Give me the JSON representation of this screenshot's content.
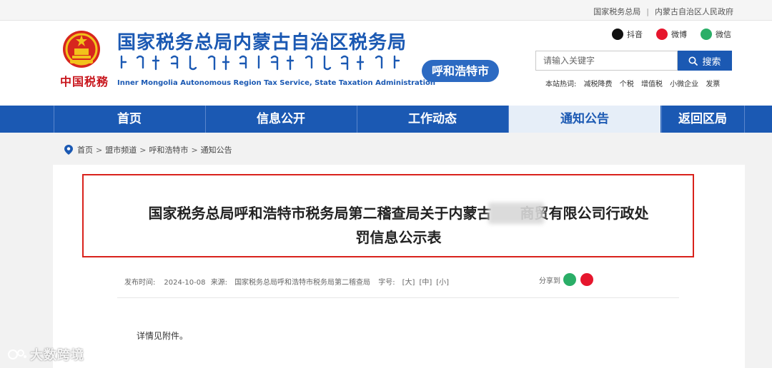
{
  "topbar": {
    "link1": "国家税务总局",
    "separator": "|",
    "link2": "内蒙古自治区人民政府"
  },
  "header": {
    "emblem_text": "中国税務",
    "title": "国家税务总局内蒙古自治区税务局",
    "subtitle": "Inner Mongolia Autonomous Region Tax Service, State Taxation Administration",
    "city_badge": "呼和浩特市",
    "social": {
      "douyin": "抖音",
      "weibo": "微博",
      "wechat": "微信"
    },
    "search": {
      "placeholder": "请输入关键字",
      "button": "搜索"
    },
    "hot": {
      "label": "本站热词:",
      "terms": [
        "减税降费",
        "个税",
        "增值税",
        "小微企业",
        "发票"
      ]
    }
  },
  "nav": {
    "items": [
      {
        "label": "首页"
      },
      {
        "label": "信息公开"
      },
      {
        "label": "工作动态"
      },
      {
        "label": "通知公告"
      },
      {
        "label": "返回区局"
      }
    ],
    "active_index": 3
  },
  "breadcrumb": {
    "items": [
      "首页",
      "盟市频道",
      "呼和浩特市",
      "通知公告"
    ],
    "sep": ">"
  },
  "article": {
    "title_line1": "国家税务总局呼和浩特市税务局第二稽查局关于内蒙古",
    "title_line1b": "商贸有限公司行政处",
    "title_line2": "罚信息公示表",
    "meta": {
      "date_label": "发布时间:",
      "date": "2024-10-08",
      "source_label": "来源:",
      "source": "国家税务总局呼和浩特市税务局第二稽查局",
      "size_label": "字号:",
      "size_large": "[大]",
      "size_medium": "[中]",
      "size_small": "[小]"
    },
    "share_label": "分享到",
    "body": "详情见附件。"
  },
  "watermark": "大数跨境",
  "colors": {
    "brand_blue": "#1b59b3",
    "highlight_red": "#d9221c",
    "wechat_green": "#2aae67",
    "weibo_red": "#e6162d"
  }
}
